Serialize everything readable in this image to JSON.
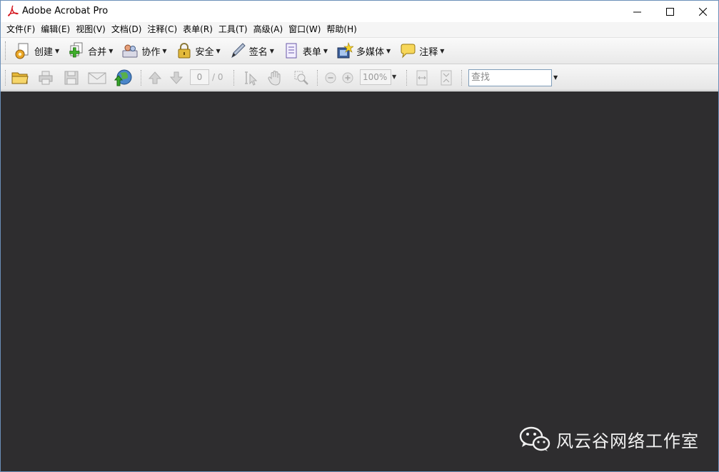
{
  "window": {
    "title": "Adobe Acrobat Pro"
  },
  "menu": [
    "文件(F)",
    "编辑(E)",
    "视图(V)",
    "文档(D)",
    "注释(C)",
    "表单(R)",
    "工具(T)",
    "高级(A)",
    "窗口(W)",
    "帮助(H)"
  ],
  "toolbar1": [
    {
      "label": "创建",
      "icon": "create-icon"
    },
    {
      "label": "合并",
      "icon": "combine-icon"
    },
    {
      "label": "协作",
      "icon": "collaborate-icon"
    },
    {
      "label": "安全",
      "icon": "lock-icon"
    },
    {
      "label": "签名",
      "icon": "pen-icon"
    },
    {
      "label": "表单",
      "icon": "form-icon"
    },
    {
      "label": "多媒体",
      "icon": "multimedia-icon"
    },
    {
      "label": "注释",
      "icon": "comment-icon"
    }
  ],
  "toolbar2": {
    "page_current": "0",
    "page_total": "/ 0",
    "zoom": "100%",
    "search_placeholder": "查找"
  },
  "watermark": {
    "text": "风云谷网络工作室"
  },
  "colors": {
    "document_bg": "#2e2d2f",
    "window_border": "#6b8fb8",
    "acrobat_red": "#d4141c"
  }
}
